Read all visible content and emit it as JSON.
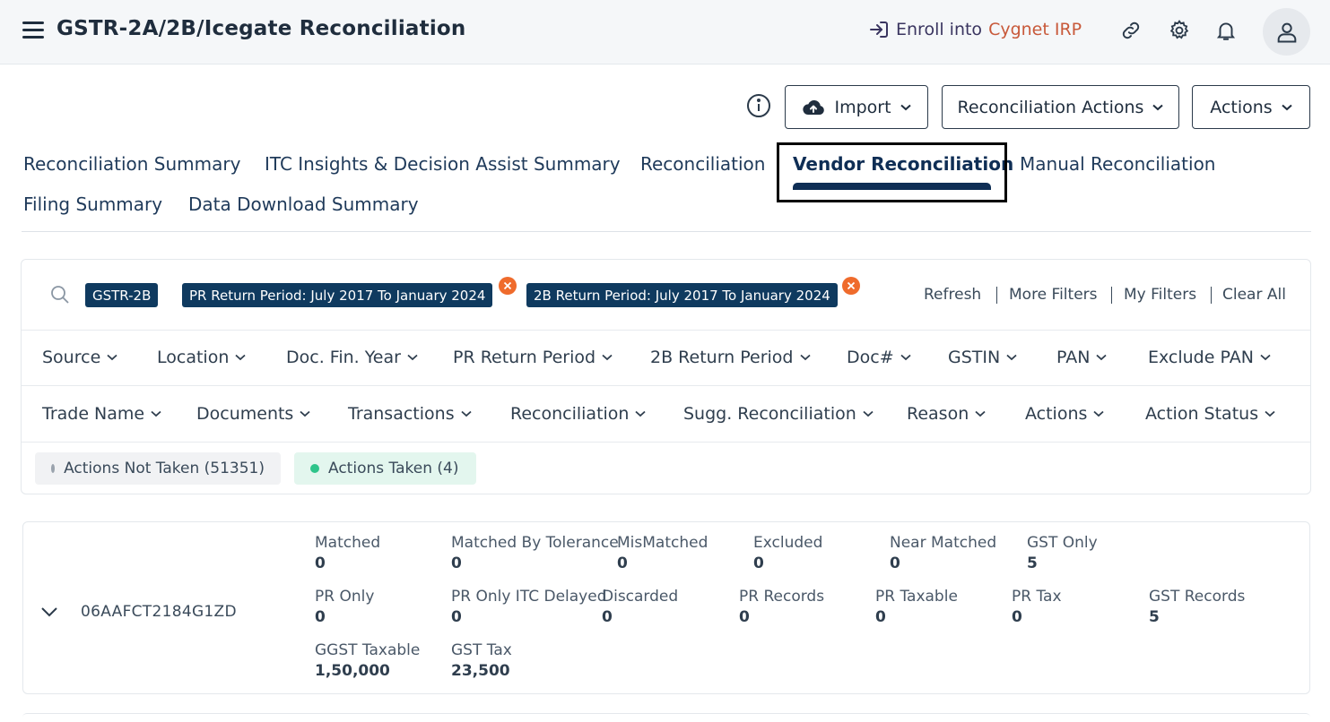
{
  "header": {
    "title": "GSTR-2A/2B/Icegate Reconciliation",
    "enroll_prefix": "Enroll into",
    "enroll_brand": "Cygnet IRP",
    "icons": [
      "menu-icon",
      "enroll-icon",
      "link-icon",
      "gear-icon",
      "bell-icon",
      "user-icon"
    ]
  },
  "toolbar": {
    "import_label": "Import",
    "recon_actions_label": "Reconciliation Actions",
    "actions_label": "Actions"
  },
  "tabs": [
    {
      "label": "Reconciliation Summary"
    },
    {
      "label": "ITC Insights & Decision Assist Summary"
    },
    {
      "label": "Reconciliation"
    },
    {
      "label": "Vendor Reconciliation",
      "active": true
    },
    {
      "label": "Manual Reconciliation"
    },
    {
      "label": "Filing Summary"
    },
    {
      "label": "Data Download Summary"
    }
  ],
  "filters": {
    "chips": [
      {
        "label": "GSTR-2B"
      },
      {
        "label": "PR Return Period: July 2017 To January 2024"
      },
      {
        "label": "2B Return Period: July 2017 To January 2024"
      }
    ],
    "links": [
      "Refresh",
      "More Filters",
      "My Filters",
      "Clear All"
    ],
    "row1": [
      "Source",
      "Location",
      "Doc. Fin. Year",
      "PR Return Period",
      "2B Return Period",
      "Doc#",
      "GSTIN",
      "PAN",
      "Exclude PAN"
    ],
    "row2": [
      "Trade Name",
      "Documents",
      "Transactions",
      "Reconciliation",
      "Sugg. Reconciliation",
      "Reason",
      "Actions",
      "Action Status"
    ]
  },
  "status_pills": {
    "not_taken": "Actions Not Taken (51351)",
    "taken": "Actions Taken (4)"
  },
  "colors": {
    "primary": "#0f2e55",
    "chip_bg": "#0f3a5f",
    "chip_close": "#ef6b2c",
    "brand": "#c8593a",
    "taken_dot": "#2ec48a",
    "not_taken_dot": "#9aa3ad"
  },
  "vendor": {
    "gstin": "06AAFCT2184G1ZD",
    "metrics": [
      {
        "label": "Matched",
        "value": "0"
      },
      {
        "label": "Matched By Tolerance",
        "value": "0"
      },
      {
        "label": "MisMatched",
        "value": "0"
      },
      {
        "label": "Excluded",
        "value": "0"
      },
      {
        "label": "Near Matched",
        "value": "0"
      },
      {
        "label": "GST Only",
        "value": "5"
      },
      {
        "label": "PR Only",
        "value": "0"
      },
      {
        "label": "PR Only ITC Delayed",
        "value": "0"
      },
      {
        "label": "Discarded",
        "value": "0"
      },
      {
        "label": "PR Records",
        "value": "0"
      },
      {
        "label": "PR Taxable",
        "value": "0"
      },
      {
        "label": "PR Tax",
        "value": "0"
      },
      {
        "label": "GST Records",
        "value": "5"
      },
      {
        "label": "GGST Taxable",
        "value": "1,50,000"
      },
      {
        "label": "GST Tax",
        "value": "23,500"
      }
    ]
  }
}
